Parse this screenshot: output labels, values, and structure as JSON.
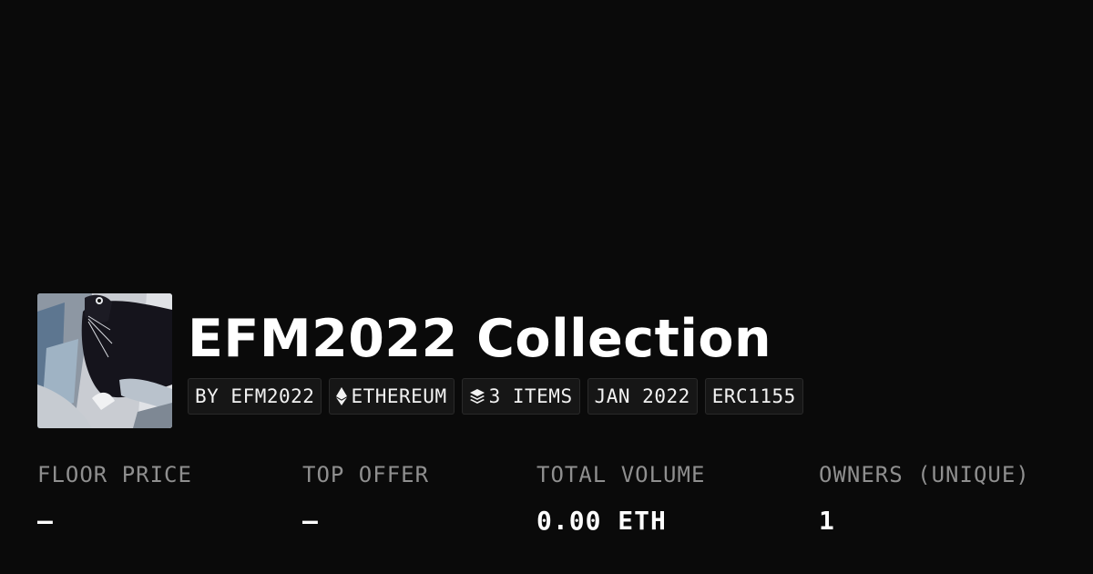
{
  "collection": {
    "title": "EFM2022 Collection",
    "image_alt": "Black and white cat artwork"
  },
  "tags": [
    {
      "label": "BY EFM2022",
      "icon": ""
    },
    {
      "label": "ETHEREUM",
      "icon": "ethereum-icon"
    },
    {
      "label": "3 ITEMS",
      "icon": "layers-icon"
    },
    {
      "label": "JAN 2022",
      "icon": ""
    },
    {
      "label": "ERC1155",
      "icon": ""
    }
  ],
  "stats": [
    {
      "label": "FLOOR PRICE",
      "value": "—"
    },
    {
      "label": "TOP OFFER",
      "value": "—"
    },
    {
      "label": "TOTAL VOLUME",
      "value": "0.00 ETH"
    },
    {
      "label": "OWNERS (UNIQUE)",
      "value": "1"
    }
  ],
  "colors": {
    "background": "#0a0a0a",
    "tag_background": "#161616",
    "label": "#8f8f8f",
    "text": "#ffffff"
  }
}
